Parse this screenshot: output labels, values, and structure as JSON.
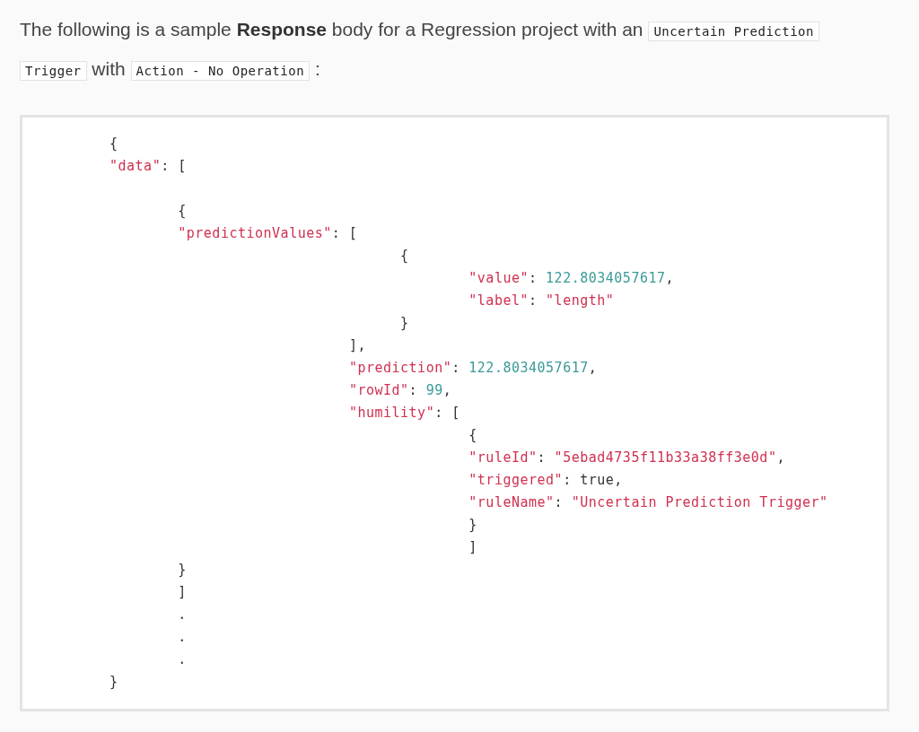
{
  "intro": [
    {
      "kind": "text",
      "text": "The following is a sample **Response** body for a Regression project with an"
    },
    {
      "kind": "code",
      "text": "Uncertain Prediction"
    },
    {
      "kind": "code",
      "text": "Trigger"
    },
    {
      "kind": "text",
      "text": "with"
    },
    {
      "kind": "code",
      "text": "Action - No Operation"
    },
    {
      "kind": "text",
      "text": ":"
    }
  ],
  "code_lines": [
    {
      "tokens": [
        {
          "kind": "punct",
          "text": "{"
        }
      ]
    },
    {
      "tokens": [
        {
          "kind": "key",
          "text": "\"data\""
        },
        {
          "kind": "punct",
          "text": ": ["
        }
      ]
    },
    {
      "gap_before": true,
      "tokens": [
        {
          "kind": "punct",
          "text": "        {"
        }
      ]
    },
    {
      "tokens": [
        {
          "kind": "key",
          "text": "        \"predictionValues\""
        },
        {
          "kind": "punct",
          "text": ": ["
        }
      ]
    },
    {
      "tokens": [
        {
          "kind": "punct",
          "text": "                                  {"
        }
      ]
    },
    {
      "tokens": [
        {
          "kind": "key",
          "text": "                                          \"value\""
        },
        {
          "kind": "punct",
          "text": ": "
        },
        {
          "kind": "number",
          "text": "122.8034057617"
        },
        {
          "kind": "punct",
          "text": ","
        }
      ]
    },
    {
      "tokens": [
        {
          "kind": "key",
          "text": "                                          \"label\""
        },
        {
          "kind": "punct",
          "text": ": "
        },
        {
          "kind": "string",
          "text": "\"length\""
        }
      ]
    },
    {
      "tokens": [
        {
          "kind": "punct",
          "text": "                                  }"
        }
      ]
    },
    {
      "tokens": [
        {
          "kind": "punct",
          "text": "                            ],"
        }
      ]
    },
    {
      "tokens": [
        {
          "kind": "key",
          "text": "                            \"prediction\""
        },
        {
          "kind": "punct",
          "text": ": "
        },
        {
          "kind": "number",
          "text": "122.8034057617"
        },
        {
          "kind": "punct",
          "text": ","
        }
      ]
    },
    {
      "tokens": [
        {
          "kind": "key",
          "text": "                            \"rowId\""
        },
        {
          "kind": "punct",
          "text": ": "
        },
        {
          "kind": "number",
          "text": "99"
        },
        {
          "kind": "punct",
          "text": ","
        }
      ]
    },
    {
      "tokens": [
        {
          "kind": "key",
          "text": "                            \"humility\""
        },
        {
          "kind": "punct",
          "text": ": ["
        }
      ]
    },
    {
      "tokens": [
        {
          "kind": "punct",
          "text": "                                          {"
        }
      ]
    },
    {
      "tokens": [
        {
          "kind": "key",
          "text": "                                          \"ruleId\""
        },
        {
          "kind": "punct",
          "text": ": "
        },
        {
          "kind": "string",
          "text": "\"5ebad4735f11b33a38ff3e0d\""
        },
        {
          "kind": "punct",
          "text": ","
        }
      ]
    },
    {
      "tokens": [
        {
          "kind": "key",
          "text": "                                          \"triggered\""
        },
        {
          "kind": "punct",
          "text": ": true,"
        }
      ]
    },
    {
      "tokens": [
        {
          "kind": "key",
          "text": "                                          \"ruleName\""
        },
        {
          "kind": "punct",
          "text": ": "
        },
        {
          "kind": "string",
          "text": "\"Uncertain Prediction Trigger\""
        }
      ]
    },
    {
      "tokens": [
        {
          "kind": "punct",
          "text": "                                          }"
        }
      ]
    },
    {
      "tokens": [
        {
          "kind": "punct",
          "text": "                                          ]"
        }
      ]
    },
    {
      "tokens": [
        {
          "kind": "punct",
          "text": "        }"
        }
      ]
    },
    {
      "tokens": [
        {
          "kind": "punct",
          "text": "        ]"
        }
      ]
    },
    {
      "tokens": [
        {
          "kind": "punct",
          "text": "        ."
        }
      ]
    },
    {
      "tokens": [
        {
          "kind": "punct",
          "text": "        ."
        }
      ]
    },
    {
      "tokens": [
        {
          "kind": "punct",
          "text": "        ."
        }
      ]
    },
    {
      "tokens": [
        {
          "kind": "punct",
          "text": "}"
        }
      ]
    }
  ]
}
